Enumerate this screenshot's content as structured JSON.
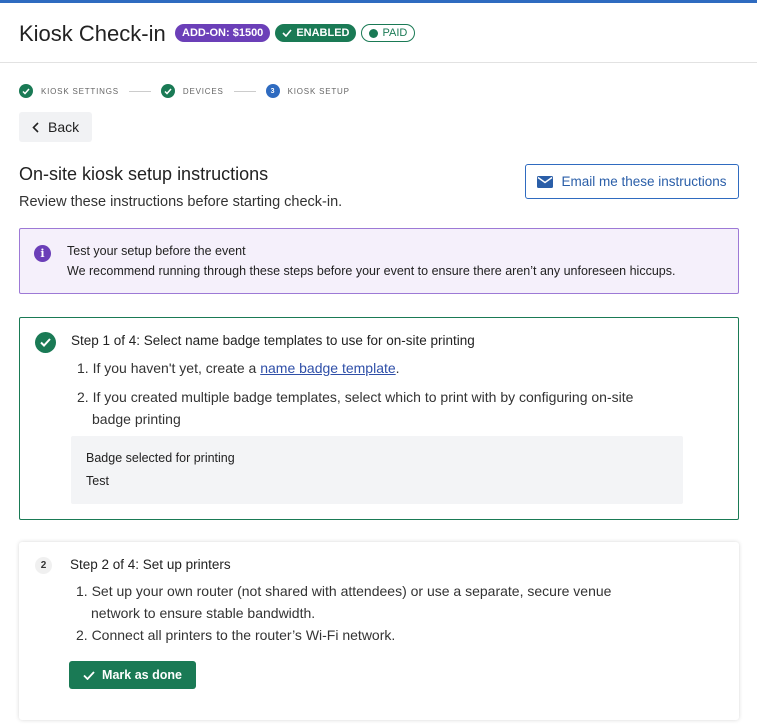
{
  "header": {
    "title": "Kiosk Check-in",
    "badges": {
      "addon": "ADD-ON: $1500",
      "enabled": "ENABLED",
      "paid": "PAID"
    }
  },
  "stepper": {
    "steps": [
      {
        "label": "KIOSK SETTINGS",
        "status": "done"
      },
      {
        "label": "DEVICES",
        "status": "done"
      },
      {
        "label": "KIOSK SETUP",
        "status": "current",
        "number": "3"
      }
    ]
  },
  "nav": {
    "back_label": "Back"
  },
  "main": {
    "heading": "On-site kiosk setup instructions",
    "subheading": "Review these instructions before starting check-in.",
    "email_button": "Email me these instructions"
  },
  "info": {
    "title": "Test your setup before the event",
    "body": "We recommend running through these steps before your event to ensure there aren’t any unforeseen hiccups."
  },
  "step1": {
    "title": "Step 1 of 4: Select name badge templates to use for on-site printing",
    "item1_prefix": "1. If you haven't yet, create a ",
    "item1_link": "name badge template",
    "item1_suffix": ".",
    "item2_line1": "2. If you created multiple badge templates, select which to print with by configuring on-site",
    "item2_line2": "badge printing",
    "selected_label": "Badge selected for printing",
    "selected_value": "Test"
  },
  "step2": {
    "number": "2",
    "title": "Step 2 of 4: Set up printers",
    "item1_line1": "1. Set up your own router (not shared with attendees) or use a separate, secure venue",
    "item1_line2": "network to ensure stable bandwidth.",
    "item2": "2. Connect all printers to the router’s Wi-Fi network.",
    "done_button": "Mark as done"
  },
  "colors": {
    "accent": "#2f6bc0",
    "success": "#1a7a55",
    "purple": "#6b3fb8"
  }
}
